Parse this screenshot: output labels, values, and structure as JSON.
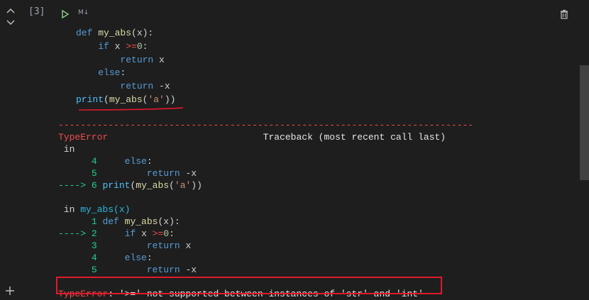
{
  "cell": {
    "execution_count": "[3]",
    "type_label": "M↓"
  },
  "code_lines": [
    "def my_abs(x):",
    "    if x >=0:",
    "        return x",
    "    else:",
    "        return -x",
    "print(my_abs('a'))"
  ],
  "output": {
    "dashes": "---------------------------------------------------------------------------",
    "error_name": "TypeError",
    "traceback_header": "Traceback (most recent call last)",
    "in_label": " in",
    "frame1": [
      {
        "marker": "      ",
        "lineno": "4",
        "code": "    else:"
      },
      {
        "marker": "      ",
        "lineno": "5",
        "code": "        return -x"
      },
      {
        "marker": "----> ",
        "lineno": "6",
        "code": "print(my_abs('a'))"
      }
    ],
    "in_label2": " in ",
    "frame2_func": "my_abs(x)",
    "frame2": [
      {
        "marker": "      ",
        "lineno": "1",
        "code": "def my_abs(x):"
      },
      {
        "marker": "----> ",
        "lineno": "2",
        "code": "    if x >=0:"
      },
      {
        "marker": "      ",
        "lineno": "3",
        "code": "        return x"
      },
      {
        "marker": "      ",
        "lineno": "4",
        "code": "    else:"
      },
      {
        "marker": "      ",
        "lineno": "5",
        "code": "        return -x"
      }
    ],
    "final_error_name": "TypeError",
    "final_error_msg": ": '>=' not supported between instances of 'str' and 'int'"
  },
  "colors": {
    "background": "#1e1e1e",
    "error": "#f14c4c",
    "highlight_box": "#e0192a",
    "annotation_line": "#e0192a"
  },
  "icons": {
    "collapse_up": "chevron-up-icon",
    "collapse_down": "chevron-down-icon",
    "run": "play-icon",
    "delete": "trash-icon",
    "add_cell": "plus-icon"
  }
}
